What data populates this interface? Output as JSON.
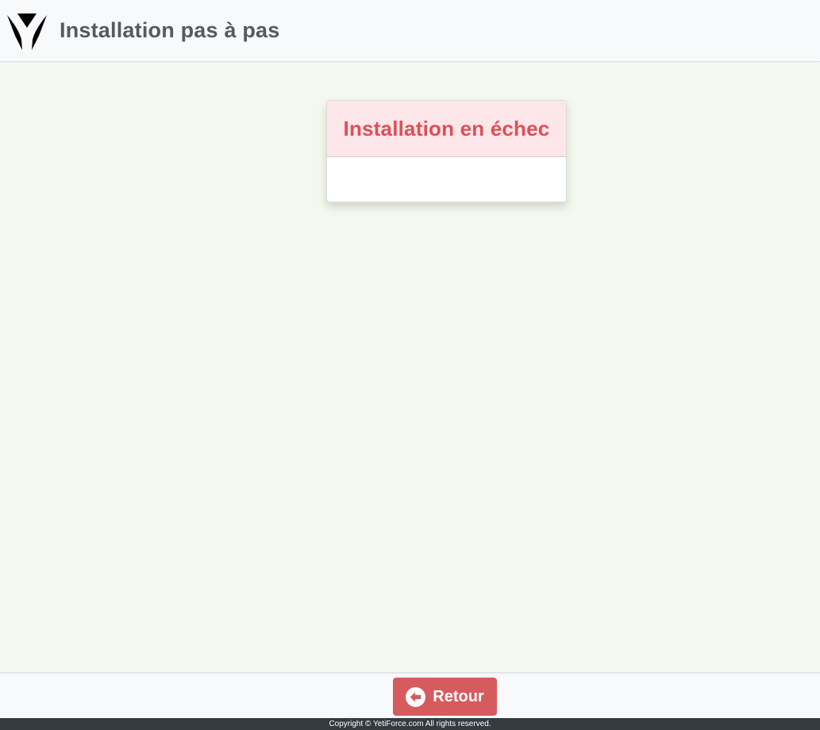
{
  "header": {
    "logo_icon": "yetiforce-logo-icon",
    "title": "Installation pas à pas"
  },
  "status_card": {
    "title": "Installation en échec",
    "title_color": "#dc5058",
    "header_background": "#fde6e9",
    "body_text": ""
  },
  "actions": {
    "back_label": "Retour",
    "back_icon": "arrow-circle-left-icon",
    "back_color": "#d55b5e"
  },
  "footer": {
    "copyright": "Copyright © YetiForce.com All rights reserved."
  }
}
